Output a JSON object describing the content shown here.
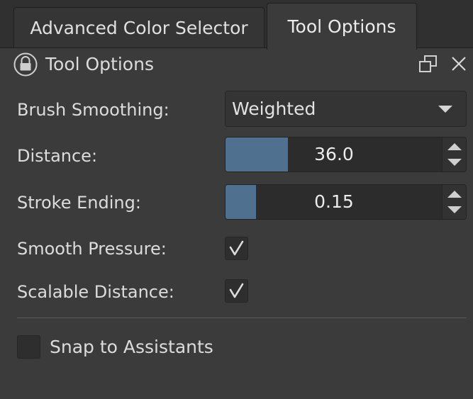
{
  "tabs": [
    {
      "label": "Advanced Color Selector",
      "active": false
    },
    {
      "label": "Tool Options",
      "active": true
    }
  ],
  "docker": {
    "title": "Tool Options",
    "icons": {
      "lock": "lock-icon",
      "float": "float-icon",
      "close": "close-icon"
    }
  },
  "options": {
    "brush_smoothing": {
      "label": "Brush Smoothing:",
      "value": "Weighted"
    },
    "distance": {
      "label": "Distance:",
      "value": "36.0",
      "fill_fraction": 0.29
    },
    "stroke_ending": {
      "label": "Stroke Ending:",
      "value": "0.15",
      "fill_fraction": 0.14
    },
    "smooth_pressure": {
      "label": "Smooth Pressure:",
      "checked": true
    },
    "scalable_distance": {
      "label": "Scalable Distance:",
      "checked": true
    },
    "snap_to_assistants": {
      "label": "Snap to Assistants",
      "checked": false
    }
  },
  "colors": {
    "background": "#3b3b3b",
    "slider_fill": "#50708f",
    "text": "#dcdcdc"
  }
}
